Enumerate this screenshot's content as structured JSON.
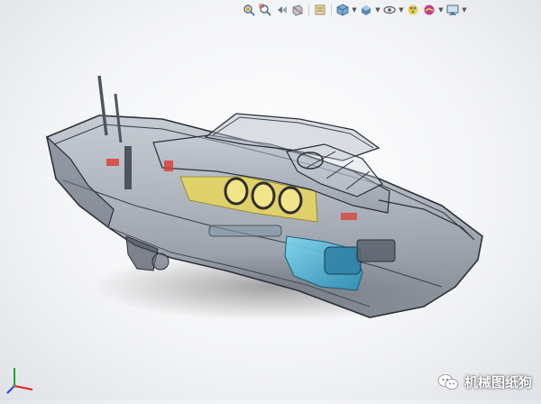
{
  "toolbar": {
    "items": [
      {
        "icon": "zoom-to-fit-icon"
      },
      {
        "icon": "zoom-to-area-icon"
      },
      {
        "icon": "previous-view-icon"
      },
      {
        "icon": "section-view-icon"
      },
      {
        "icon": "dynamic-annotation-icon"
      },
      {
        "icon": "view-orientation-icon"
      },
      {
        "icon": "display-style-icon"
      },
      {
        "icon": "hide-show-items-icon"
      },
      {
        "icon": "edit-appearance-icon"
      },
      {
        "icon": "apply-scene-icon"
      },
      {
        "icon": "view-settings-icon"
      }
    ]
  },
  "model": {
    "name": "boat-assembly-transparent",
    "colors": {
      "hull": "#8f9aa8",
      "cabin_yellow": "#e8d65a",
      "engine_cyan": "#49c3e6",
      "accent_red": "#d9433a",
      "porthole_ring": "#3a3a3a"
    }
  },
  "watermark": {
    "text": "机械图纸狗"
  },
  "triad": {
    "axes": [
      "x",
      "y",
      "z"
    ],
    "colors": {
      "x": "#e01f1f",
      "y": "#1fa32f",
      "z": "#2040e0"
    }
  }
}
